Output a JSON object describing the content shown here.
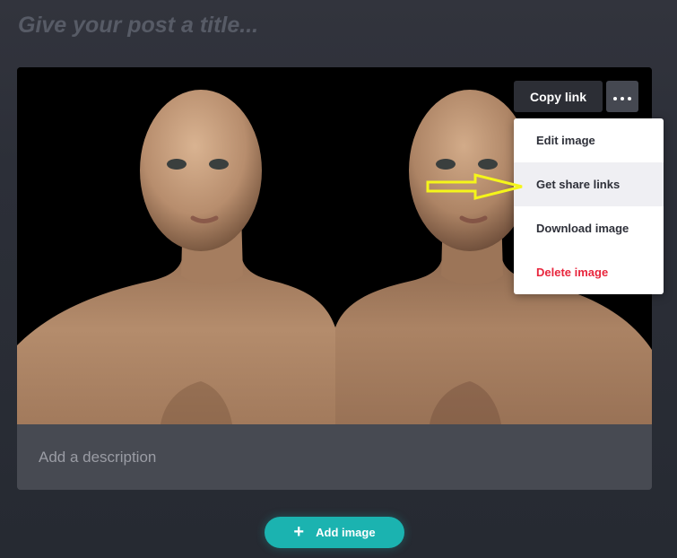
{
  "post": {
    "title_placeholder": "Give your post a title..."
  },
  "image_card": {
    "image_name": "two-female-3d-figures-image",
    "copy_link_label": "Copy link",
    "more_icon": "more-horizontal-icon",
    "description_placeholder": "Add a description"
  },
  "menu": {
    "items": [
      {
        "label": "Edit image"
      },
      {
        "label": "Get share links"
      },
      {
        "label": "Download image"
      },
      {
        "label": "Delete image"
      }
    ],
    "highlighted_index": 1,
    "danger_color": "#e8263d"
  },
  "annotation": {
    "arrow_icon": "right-arrow-icon",
    "arrow_color": "#f5f51a"
  },
  "footer": {
    "add_image_label": "Add image",
    "add_icon": "plus-icon",
    "accent_color": "#1bb3b0"
  }
}
